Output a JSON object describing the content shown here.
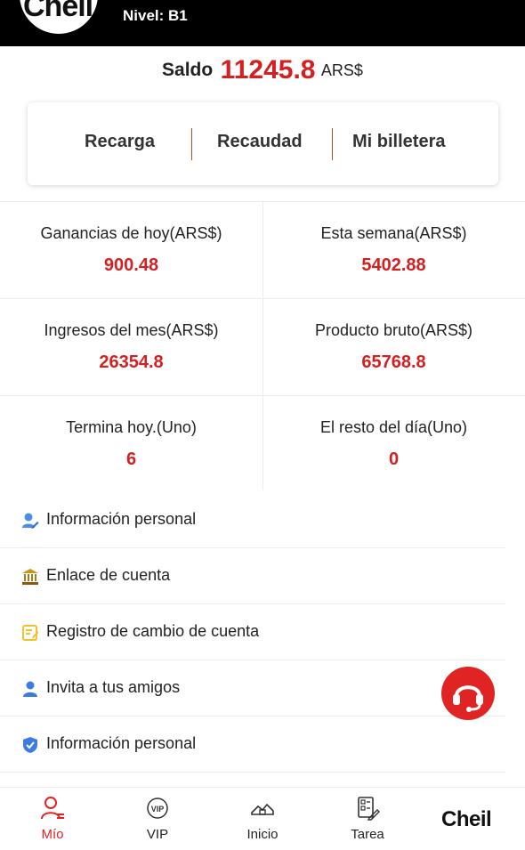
{
  "header": {
    "logo_text": "Cheil",
    "level": "Nivel: B1"
  },
  "balance": {
    "label": "Saldo",
    "amount": "11245.8",
    "currency": "ARS$"
  },
  "actions": [
    "Recarga",
    "Recaudad",
    "Mi billetera"
  ],
  "stats": [
    {
      "title": "Ganancias de hoy(ARS$)",
      "value": "900.48"
    },
    {
      "title": "Esta semana(ARS$)",
      "value": "5402.88"
    },
    {
      "title": "Ingresos del mes(ARS$)",
      "value": "26354.8"
    },
    {
      "title": "Producto bruto(ARS$)",
      "value": "65768.8"
    },
    {
      "title": "Termina hoy.(Uno)",
      "value": "6"
    },
    {
      "title": "El resto del día(Uno)",
      "value": "0"
    }
  ],
  "menu": [
    {
      "label": "Información personal",
      "icon": "user-edit-icon"
    },
    {
      "label": "Enlace de cuenta",
      "icon": "bank-icon"
    },
    {
      "label": "Registro de cambio de cuenta",
      "icon": "record-icon"
    },
    {
      "label": "Invita a tus amigos",
      "icon": "invite-user-icon"
    },
    {
      "label": "Información personal",
      "icon": "shield-check-icon"
    }
  ],
  "nav": [
    {
      "label": "Mío",
      "icon": "user-icon",
      "active": true
    },
    {
      "label": "VIP",
      "icon": "vip-icon",
      "active": false
    },
    {
      "label": "Inicio",
      "icon": "home-icon",
      "active": false
    },
    {
      "label": "Tarea",
      "icon": "task-icon",
      "active": false
    }
  ],
  "brand": "Cheil",
  "colors": {
    "accent": "#d42020",
    "topbar": "#000000",
    "support": "#e02424"
  }
}
